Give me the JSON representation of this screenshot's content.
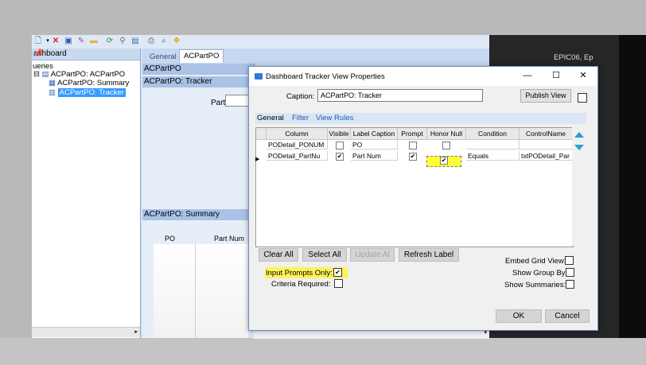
{
  "tree": {
    "header": "ashboard",
    "pin": "📌",
    "root": "ueries",
    "item_root": "ACPartPO: ACPartPO",
    "item_summary": "ACPartPO: Summary",
    "item_tracker": "ACPartPO: Tracker"
  },
  "main_tabs": [
    "General",
    "ACPartPO"
  ],
  "center": {
    "bar1": "ACPartPO",
    "bar2": "ACPartPO: Tracker",
    "partnum_label": "Part Num",
    "bar3": "ACPartPO: Summary",
    "col_po": "PO",
    "col_partnum": "Part Num"
  },
  "right": {
    "label": "EPIC06, Ep"
  },
  "dialog": {
    "title": "Dashboard Tracker View Properties",
    "minimize": "—",
    "maximize": "☐",
    "close": "✕",
    "caption_label": "Caption:",
    "caption_value": "ACPartPO: Tracker",
    "publish_label": "Publish View",
    "subtabs": [
      "General",
      "Filter",
      "View Rules"
    ],
    "columns": [
      "Column",
      "Visible",
      "Label Caption",
      "Prompt",
      "Honor Null",
      "Condition",
      "ControlName"
    ],
    "rows": [
      {
        "column": "PODetail_PONUM",
        "visible": false,
        "label": "PO",
        "prompt": false,
        "honor_null": false,
        "condition": "",
        "control": ""
      },
      {
        "column": "PODetail_PartNu",
        "visible": true,
        "label": "Part Num",
        "prompt": true,
        "honor_null": true,
        "condition": "Equals",
        "control": "txtPODetail_Par"
      }
    ],
    "buttons": {
      "clear_all": "Clear All",
      "select_all": "Select All",
      "update_all": "Update Al",
      "refresh_label": "Refresh Label",
      "ok": "OK",
      "cancel": "Cancel"
    },
    "options": {
      "input_prompts_only": "Input Prompts Only:",
      "input_prompts_only_checked": true,
      "criteria_required": "Criteria Required:",
      "criteria_required_checked": false,
      "embed_grid_view": "Embed Grid View:",
      "show_group_by": "Show Group By:",
      "show_summaries": "Show Summaries:"
    }
  },
  "colors": {
    "highlight": "#fff25a",
    "accent": "#2e7bd6",
    "app_bg": "#d7e3f4"
  }
}
